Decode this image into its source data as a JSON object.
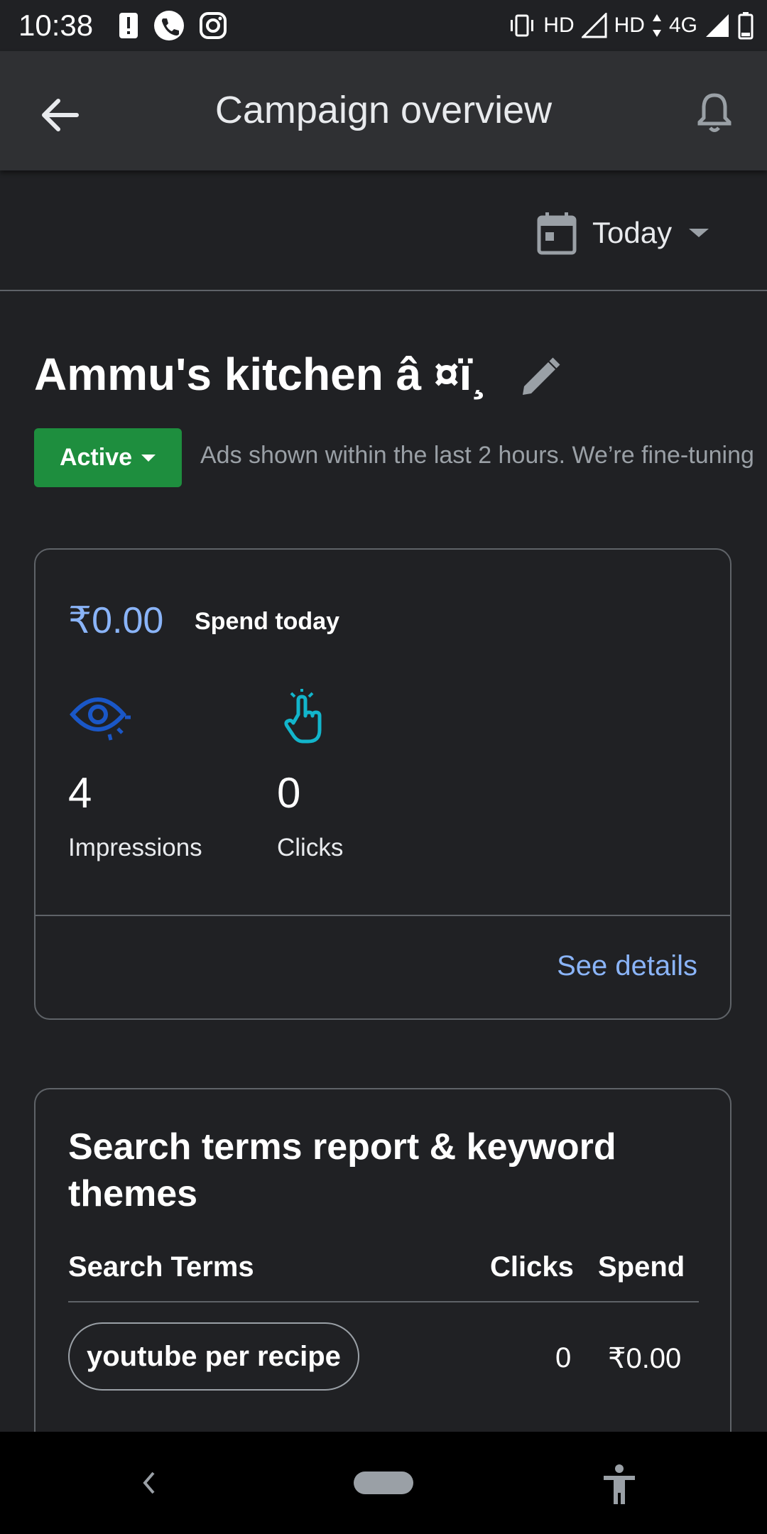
{
  "status_bar": {
    "time": "10:38",
    "network_label_1": "HD",
    "network_label_2": "HD",
    "network_label_3": "4G"
  },
  "app_bar": {
    "title": "Campaign overview",
    "back_icon": "arrow-back-icon",
    "notifications_icon": "bell-icon"
  },
  "date_filter": {
    "label": "Today",
    "icon": "calendar-icon"
  },
  "campaign": {
    "name": "Ammu's kitchen â ¤ï¸",
    "status": "Active",
    "status_note": "Ads shown within the last 2 hours. We’re fine-tuning",
    "colors": {
      "active": "#1e8e3e",
      "accent": "#8ab4f8"
    }
  },
  "summary": {
    "spend_value": "₹0.00",
    "spend_label": "Spend today",
    "metrics": [
      {
        "value": "4",
        "label": "Impressions",
        "icon": "eye-icon"
      },
      {
        "value": "0",
        "label": "Clicks",
        "icon": "tap-icon"
      }
    ],
    "see_details": "See details"
  },
  "report": {
    "title": "Search terms report & keyword themes",
    "columns": [
      "Search Terms",
      "Clicks",
      "Spend"
    ],
    "rows": [
      {
        "term": "youtube per recipe",
        "clicks": "0",
        "spend": "₹0.00"
      }
    ]
  }
}
